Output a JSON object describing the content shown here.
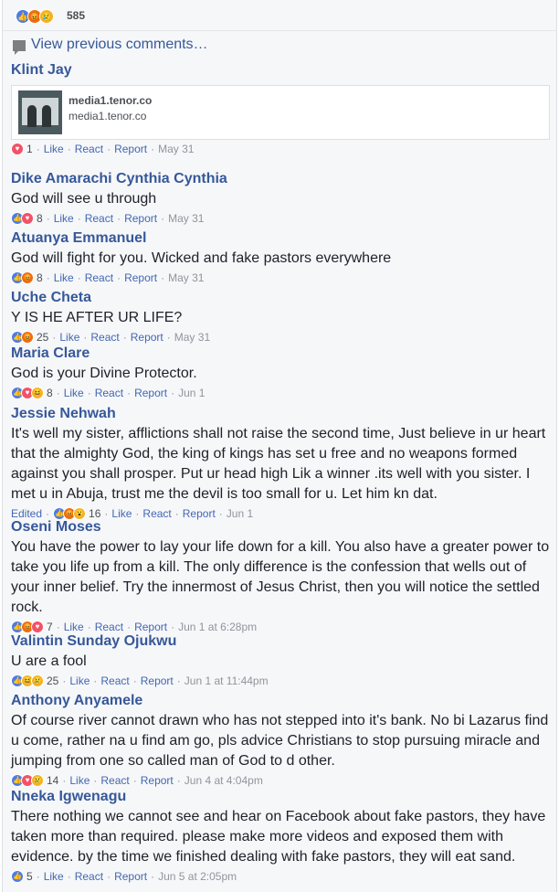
{
  "header": {
    "reactions": [
      "like",
      "angry",
      "sad"
    ],
    "count": "585"
  },
  "view_previous": "View previous comments…",
  "comments": [
    {
      "author": "Klint Jay",
      "text": "",
      "attachment": {
        "domain": "media1.tenor.co",
        "subtitle": "media1.tenor.co"
      },
      "reactions": [
        "love"
      ],
      "count": "1",
      "like": "Like",
      "react": "React",
      "report": "Report",
      "date": "May 31"
    },
    {
      "author": "Dike Amarachi Cynthia Cynthia",
      "text": "God will see u through",
      "reactions": [
        "like",
        "love"
      ],
      "count": "8",
      "like": "Like",
      "react": "React",
      "report": "Report",
      "date": "May 31"
    },
    {
      "author": "Atuanya Emmanuel",
      "text": "God will fight for you. Wicked and fake pastors everywhere",
      "reactions": [
        "like",
        "angry"
      ],
      "count": "8",
      "like": "Like",
      "react": "React",
      "report": "Report",
      "date": "May 31"
    },
    {
      "author": "Uche Cheta",
      "text": "Y IS HE AFTER UR LIFE?",
      "reactions": [
        "like",
        "angry"
      ],
      "count": "25",
      "like": "Like",
      "react": "React",
      "report": "Report",
      "date": "May 31"
    },
    {
      "author": "Maria Clare",
      "text": "God is your Divine Protector.",
      "reactions": [
        "like",
        "love",
        "haha"
      ],
      "count": "8",
      "like": "Like",
      "react": "React",
      "report": "Report",
      "date": "Jun 1"
    },
    {
      "author": "Jessie Nehwah",
      "text": "It's well my sister, afflictions shall not raise the second time, Just believe in ur heart that the almighty God, the king of kings has set u free and no weapons formed against you shall prosper. Put ur head high Lik a winner .its well with you sister. I met u in Abuja, trust me the devil is too small for u. Let him kn dat.",
      "edited": "Edited",
      "reactions": [
        "like",
        "angry",
        "wow"
      ],
      "count": "16",
      "like": "Like",
      "react": "React",
      "report": "Report",
      "date": "Jun 1"
    },
    {
      "author": "Oseni Moses",
      "text": "You have the power to lay your life down for a kill. You also have a greater power to take you life up from a kill. The only difference is the confession that wells out of your inner belief. Try the innermost of Jesus Christ, then you will notice the settled rock.",
      "reactions": [
        "like",
        "angry",
        "love"
      ],
      "count": "7",
      "like": "Like",
      "react": "React",
      "report": "Report",
      "date": "Jun 1 at 6:28pm"
    },
    {
      "author": "Valintin Sunday Ojukwu",
      "text": "U are a fool",
      "reactions": [
        "like",
        "haha",
        "sad"
      ],
      "count": "25",
      "like": "Like",
      "react": "React",
      "report": "Report",
      "date": "Jun 1 at 11:44pm"
    },
    {
      "author": "Anthony Anyamele",
      "text": "Of course river cannot drawn who has not stepped into it's bank. No bi Lazarus find u come, rather na u find am go, pls advice Christians to stop pursuing miracle and jumping from one so called man of God to d other.",
      "reactions": [
        "like",
        "love",
        "sad"
      ],
      "count": "14",
      "like": "Like",
      "react": "React",
      "report": "Report",
      "date": "Jun 4 at 4:04pm"
    },
    {
      "author": "Nneka Igwenagu",
      "text": "There nothing we cannot see and hear on Facebook about fake pastors, they have taken more than required. please make more videos and exposed them with evidence. by the time we finished dealing with fake pastors, they will eat sand.",
      "reactions": [
        "like"
      ],
      "count": "5",
      "like": "Like",
      "react": "React",
      "report": "Report",
      "date": "Jun 5 at 2:05pm"
    }
  ],
  "colors": {
    "link": "#365899",
    "meta_link": "#4267b2",
    "meta_gray": "#90949c",
    "like": "#4a7ce8",
    "love": "#f25268",
    "angry": "#e9710f",
    "yellow": "#f7b125"
  }
}
